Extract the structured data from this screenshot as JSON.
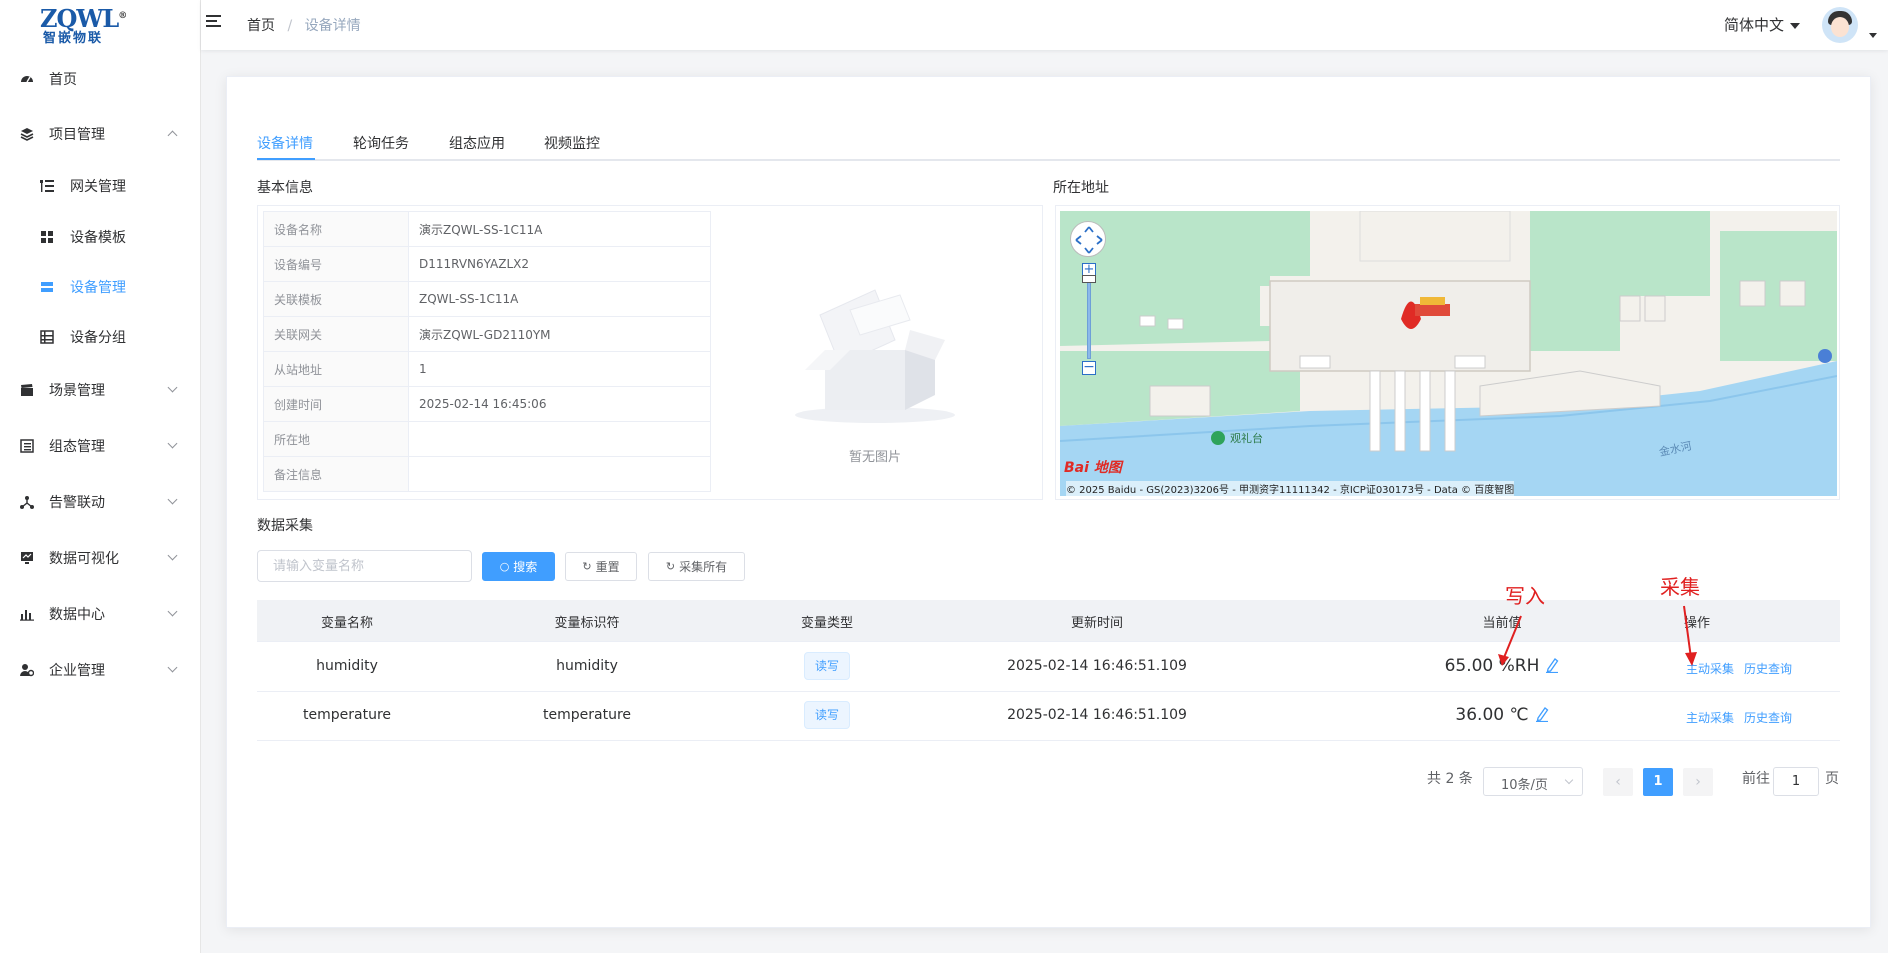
{
  "brand": {
    "logo_top": "ZQWL",
    "logo_reg": "®",
    "logo_bottom": "智嵌物联"
  },
  "sidebar": {
    "items": [
      {
        "label": "首页",
        "icon": "dashboard-icon"
      },
      {
        "label": "项目管理",
        "icon": "layers-icon",
        "expanded": true
      },
      {
        "label": "网关管理",
        "icon": "list-tree-icon"
      },
      {
        "label": "设备模板",
        "icon": "grid-icon"
      },
      {
        "label": "设备管理",
        "icon": "server-icon",
        "active": true
      },
      {
        "label": "设备分组",
        "icon": "group-icon"
      },
      {
        "label": "场景管理",
        "icon": "clapper-icon"
      },
      {
        "label": "组态管理",
        "icon": "list-icon"
      },
      {
        "label": "告警联动",
        "icon": "share-icon"
      },
      {
        "label": "数据可视化",
        "icon": "monitor-icon"
      },
      {
        "label": "数据中心",
        "icon": "bar-chart-icon"
      },
      {
        "label": "企业管理",
        "icon": "user-gear-icon"
      }
    ]
  },
  "header": {
    "breadcrumb": [
      "首页",
      "/",
      "设备详情"
    ],
    "language": "简体中文"
  },
  "tabs": [
    "设备详情",
    "轮询任务",
    "组态应用",
    "视频监控"
  ],
  "basic_info": {
    "title": "基本信息",
    "rows": [
      {
        "key": "设备名称",
        "value": "演示ZQWL-SS-1C11A"
      },
      {
        "key": "设备编号",
        "value": "D111RVN6YAZLX2"
      },
      {
        "key": "关联模板",
        "value": "ZQWL-SS-1C11A"
      },
      {
        "key": "关联网关",
        "value": "演示ZQWL-GD2110YM"
      },
      {
        "key": "从站地址",
        "value": "1"
      },
      {
        "key": "创建时间",
        "value": "2025-02-14 16:45:06"
      },
      {
        "key": "所在地",
        "value": ""
      },
      {
        "key": "备注信息",
        "value": ""
      }
    ],
    "no_image_text": "暂无图片"
  },
  "location": {
    "title": "所在地址",
    "map_labels": {
      "place1": "观礼台",
      "river": "金水河"
    },
    "baidu_logo": "Bai 地图",
    "copyright": "© 2025 Baidu - GS(2023)3206号 - 甲测资字11111342 - 京ICP证030173号 - Data © 百度智图"
  },
  "data_collection": {
    "title": "数据采集",
    "search_placeholder": "请输入变量名称",
    "buttons": {
      "search": "搜索",
      "reset": "重置",
      "collect_all": "采集所有"
    },
    "columns": [
      "变量名称",
      "变量标识符",
      "变量类型",
      "更新时间",
      "当前值",
      "操作"
    ],
    "rows": [
      {
        "name": "humidity",
        "identifier": "humidity",
        "type": "读写",
        "updated": "2025-02-14 16:46:51.109",
        "value": "65.00 %RH",
        "action1": "主动采集",
        "action2": "历史查询"
      },
      {
        "name": "temperature",
        "identifier": "temperature",
        "type": "读写",
        "updated": "2025-02-14 16:46:51.109",
        "value": "36.00 ℃",
        "action1": "主动采集",
        "action2": "历史查询"
      }
    ]
  },
  "pagination": {
    "total": "共 2 条",
    "page_size": "10条/页",
    "prev": "‹",
    "current": "1",
    "next": "›",
    "goto_prefix": "前往",
    "goto_value": "1",
    "goto_suffix": "页"
  },
  "annotations": {
    "write": "写入",
    "collect": "采集"
  },
  "colors": {
    "accent": "#409eff",
    "annotation": "#e02020"
  }
}
